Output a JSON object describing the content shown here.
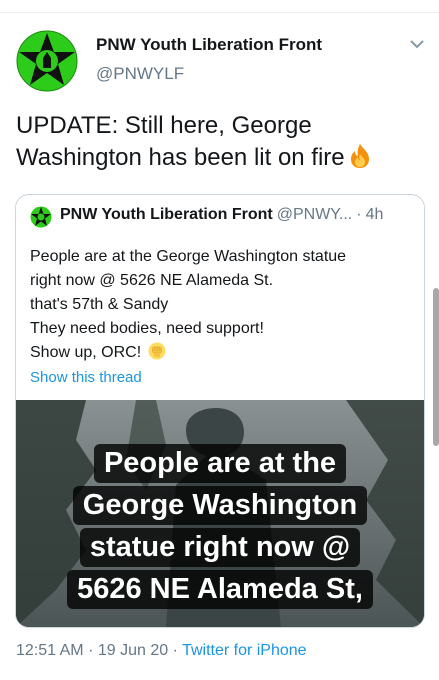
{
  "tweet": {
    "author_name": "PNW Youth Liberation Front",
    "author_handle": "@PNWYLF",
    "text": "UPDATE: Still here, George Washington has been lit on fire",
    "timestamp": "12:51 AM",
    "date": "19 Jun 20",
    "source": "Twitter for iPhone",
    "separator": "·"
  },
  "quote": {
    "author_name": "PNW Youth Liberation Front",
    "author_handle": "@PNWY...",
    "separator": "·",
    "time": "4h",
    "lines": [
      "People are at the George Washington statue",
      "right now @ 5626 NE Alameda St.",
      "that's 57th & Sandy",
      "They need bodies, need support!",
      "Show up, ORC!"
    ],
    "show_thread": "Show this thread",
    "media_caption": [
      "People are at the",
      "George Washington",
      "statue right now @",
      "5626 NE Alameda St,"
    ]
  },
  "icons": {
    "avatar": "green-star-logo-icon",
    "caret": "chevron-down-icon",
    "fire": "fire-emoji-icon",
    "fist": "raised-fist-emoji-icon"
  },
  "colors": {
    "link": "#1b95e0",
    "secondary_text": "#657786",
    "avatar_green": "#2ecc1a",
    "border": "#ccd6dd"
  }
}
